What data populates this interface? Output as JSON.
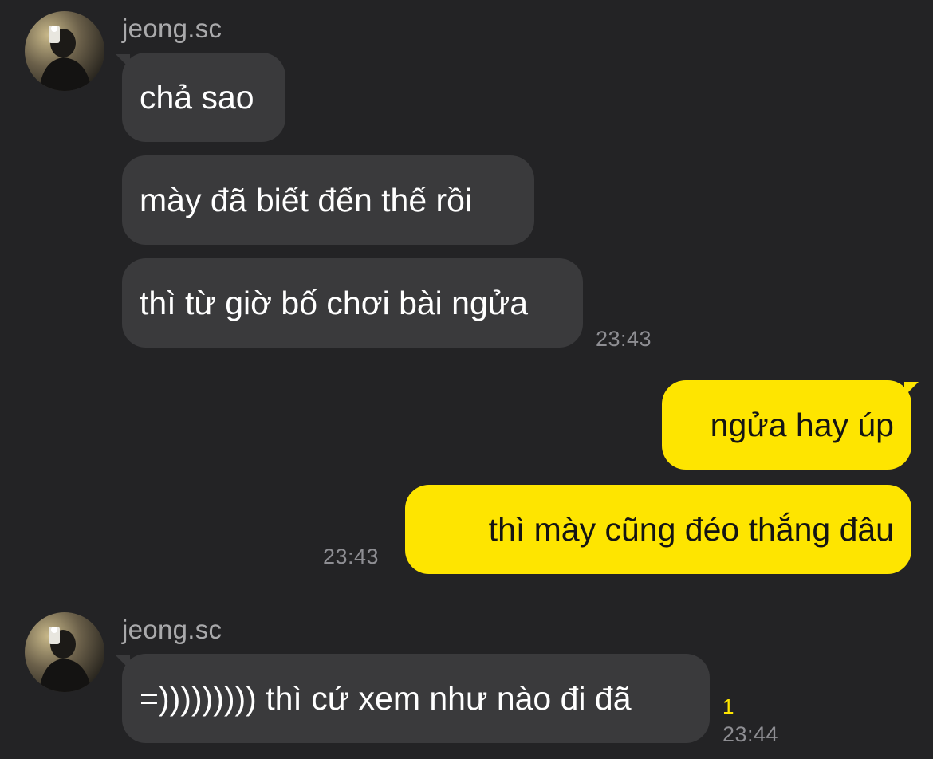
{
  "colors": {
    "background": "#232325",
    "incoming_bubble": "#3a3a3c",
    "outgoing_bubble": "#fee500",
    "unread_count": "#fee500"
  },
  "groups": [
    {
      "sender": "jeong.sc",
      "avatar_icon": "profile-photo-avatar",
      "messages": [
        "chả sao",
        "mày đã biết đến thế rồi",
        "thì từ giờ bố chơi bài ngửa"
      ],
      "time": "23:43"
    },
    {
      "sender": "me",
      "messages": [
        "ngửa hay úp",
        "thì mày cũng đéo thắng đâu"
      ],
      "time": "23:43"
    },
    {
      "sender": "jeong.sc",
      "avatar_icon": "profile-photo-avatar",
      "messages": [
        "=))))))))) thì cứ xem như nào đi đã"
      ],
      "unread": "1",
      "time": "23:44"
    }
  ]
}
